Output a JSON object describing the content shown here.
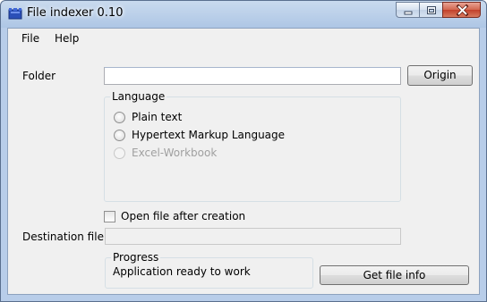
{
  "window": {
    "title": "File indexer 0.10"
  },
  "menu": {
    "items": [
      "File",
      "Help"
    ]
  },
  "folder": {
    "label": "Folder",
    "value": "",
    "origin_button": "Origin"
  },
  "language": {
    "title": "Language",
    "options": [
      {
        "label": "Plain text",
        "enabled": true,
        "selected": false
      },
      {
        "label": "Hypertext Markup Language",
        "enabled": true,
        "selected": false
      },
      {
        "label": "Excel-Workbook",
        "enabled": false,
        "selected": false
      }
    ]
  },
  "open_after": {
    "label": "Open file after creation",
    "checked": false
  },
  "destination": {
    "label": "Destination file",
    "value": ""
  },
  "progress": {
    "title": "Progress",
    "status": "Application ready to work"
  },
  "actions": {
    "get_file_info": "Get file info"
  }
}
